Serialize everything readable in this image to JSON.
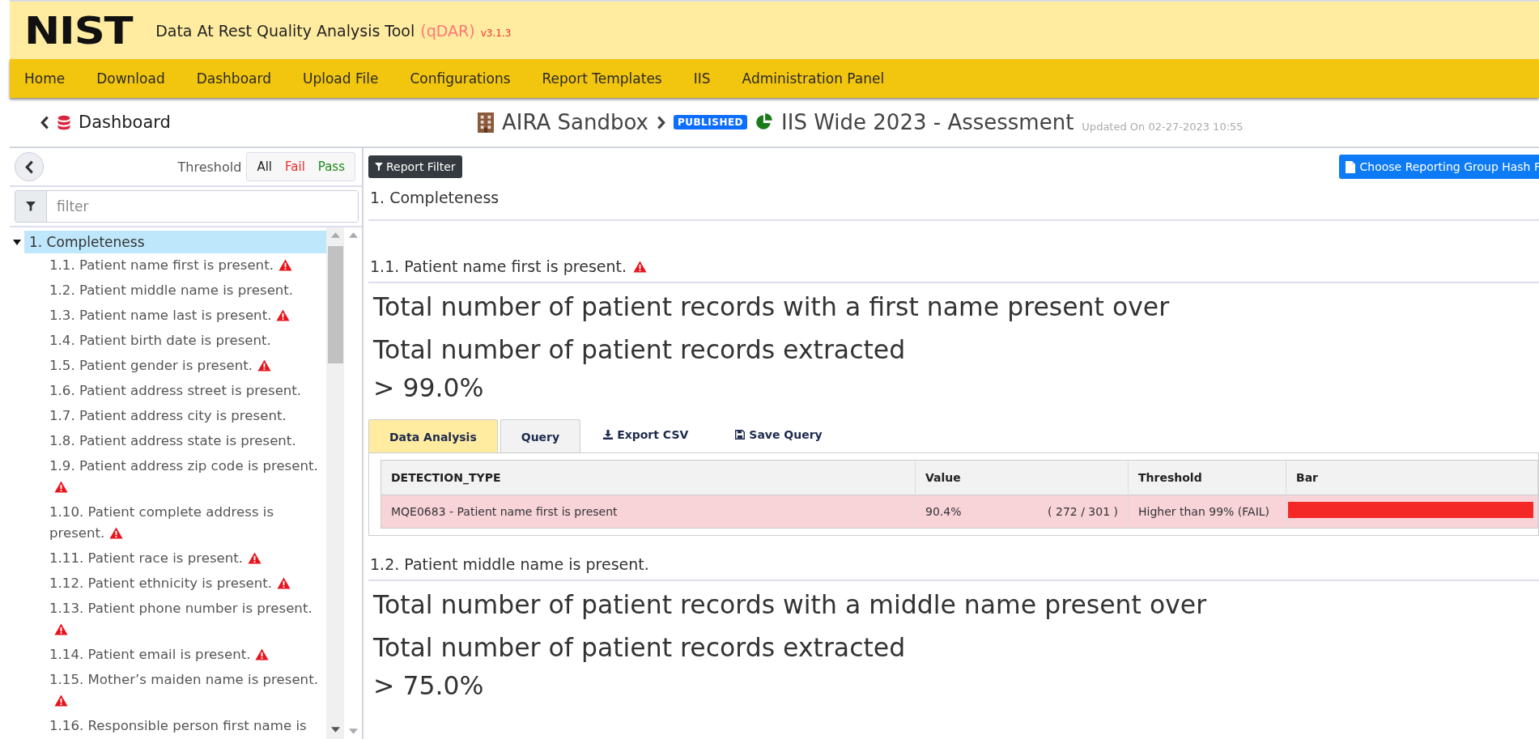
{
  "header": {
    "logo": "NIST",
    "title": "Data At Rest Quality Analysis Tool",
    "acronym": "(qDAR)",
    "version": "v3.1.3"
  },
  "nav": [
    "Home",
    "Download",
    "Dashboard",
    "Upload File",
    "Configurations",
    "Report Templates",
    "IIS",
    "Administration Panel"
  ],
  "breadcrumb": {
    "back": "Dashboard",
    "organization": "AIRA Sandbox",
    "badge": "PUBLISHED",
    "report": "IIS Wide 2023 - Assessment",
    "updated": "Updated On 02-27-2023 10:55"
  },
  "sidebar": {
    "threshold_label": "Threshold",
    "threshold_options": [
      {
        "label": "All",
        "kind": "all"
      },
      {
        "label": "Fail",
        "kind": "fail"
      },
      {
        "label": "Pass",
        "kind": "pass"
      }
    ],
    "filter": {
      "placeholder": "filter"
    },
    "tree": [
      {
        "label": "1. Completeness",
        "expanded": true,
        "selected": true,
        "children": [
          {
            "label": "1.1. Patient name first is present.",
            "fail": true,
            "selected": false
          },
          {
            "label": "1.2. Patient middle name is present.",
            "fail": false,
            "selected": false
          },
          {
            "label": "1.3. Patient name last is present.",
            "fail": true,
            "selected": false
          },
          {
            "label": "1.4. Patient birth date is present.",
            "fail": false,
            "selected": false
          },
          {
            "label": "1.5. Patient gender is present.",
            "fail": true,
            "selected": false
          },
          {
            "label": "1.6. Patient address street is present.",
            "fail": false,
            "selected": false
          },
          {
            "label": "1.7. Patient address city is present.",
            "fail": false,
            "selected": false
          },
          {
            "label": "1.8. Patient address state is present.",
            "fail": false,
            "selected": false
          },
          {
            "label": "1.9. Patient address zip code is present.",
            "fail": true,
            "selected": false
          },
          {
            "label": "1.10. Patient complete address is present.",
            "fail": true,
            "selected": false
          },
          {
            "label": "1.11. Patient race is present.",
            "fail": true,
            "selected": false
          },
          {
            "label": "1.12. Patient ethnicity is present.",
            "fail": true,
            "selected": false
          },
          {
            "label": "1.13. Patient phone number is present.",
            "fail": true,
            "selected": false
          },
          {
            "label": "1.14. Patient email is present.",
            "fail": true,
            "selected": false
          },
          {
            "label": "1.15. Mother’s maiden name is present.",
            "fail": true,
            "selected": false
          },
          {
            "label": "1.16. Responsible person first name is",
            "fail": false,
            "selected": false
          }
        ]
      }
    ]
  },
  "toolbar": {
    "report_filter": "Report Filter",
    "reporting_group": "Choose Reporting Group Hash F"
  },
  "section_title": "1. Completeness",
  "measures": [
    {
      "title": "1.1. Patient name first is present.",
      "fail": true,
      "description": [
        "Total number of patient records with a first name present over",
        "Total number of patient records extracted"
      ],
      "target": "> 99.0%",
      "tabs": [
        {
          "label": "Data Analysis",
          "selected": true
        },
        {
          "label": "Query",
          "selected": false
        }
      ],
      "actions": [
        {
          "label": "Export CSV",
          "kind": "download"
        },
        {
          "label": "Save Query",
          "kind": "save"
        }
      ],
      "table": {
        "columns": [
          "DETECTION_TYPE",
          "Value",
          "Threshold",
          "Bar"
        ],
        "rows": [
          {
            "detection_type": "MQE0683 - Patient name first is present",
            "value": "90.4%",
            "count": "( 272 / 301 )",
            "threshold": "Higher than 99% (FAIL)",
            "fail": true,
            "level": 0.99
          }
        ]
      }
    },
    {
      "title": "1.2. Patient middle name is present.",
      "fail": false,
      "description": [
        "Total number of patient records with a middle name present over",
        "Total number of patient records extracted"
      ],
      "target": "> 75.0%"
    }
  ]
}
